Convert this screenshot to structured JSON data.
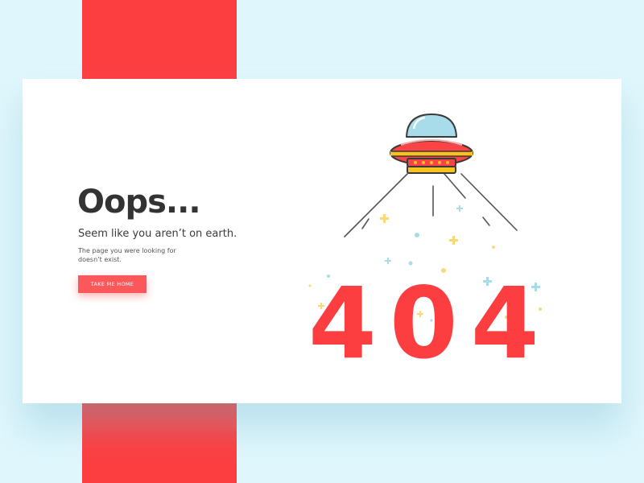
{
  "page": {
    "heading": "Oops...",
    "subheading": "Seem like you aren’t on earth.",
    "description": "The page you were looking for doesn’t exist.",
    "home_button_label": "TAKE ME HOME",
    "error_code": "404"
  },
  "colors": {
    "background": "#dff6fc",
    "accent_red": "#fc3e41",
    "button_red": "#fa585a",
    "card": "#ffffff",
    "text_dark": "#333333",
    "ufo_dome": "#a9dcea",
    "ufo_gold": "#f9c21e",
    "sparkle_yellow": "#fbd77a",
    "sparkle_blue": "#a9dcea"
  },
  "icons": {
    "ufo": "ufo-icon",
    "sparkles": "sparkle-icon"
  }
}
